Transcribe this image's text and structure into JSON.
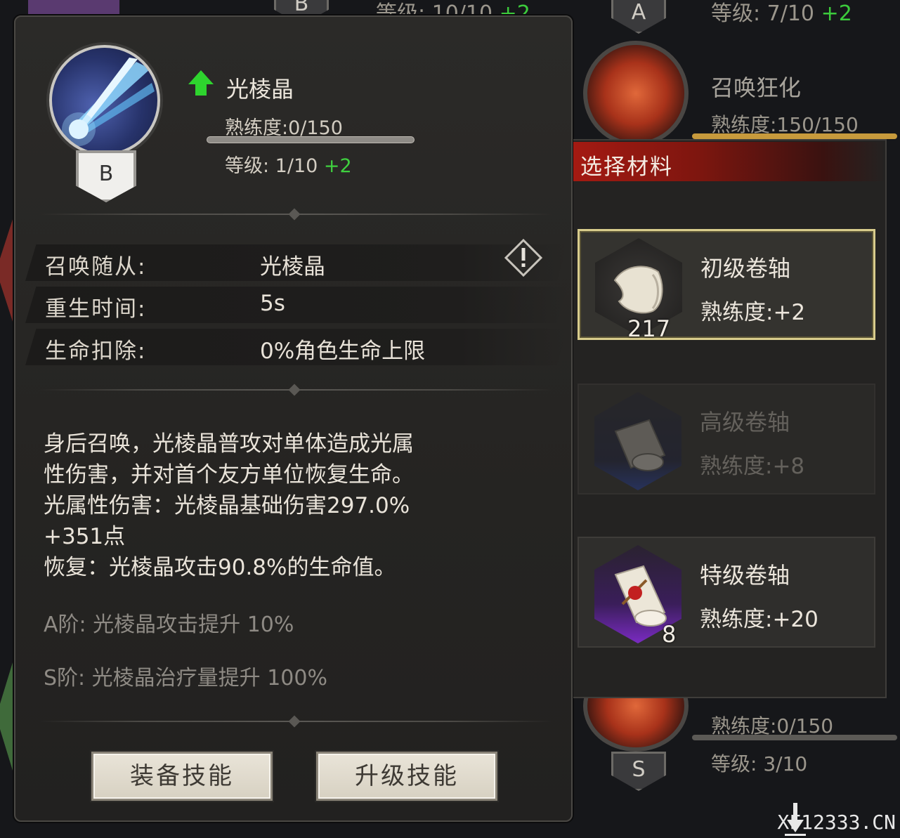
{
  "background": {
    "top_rank_left": "B",
    "top_level_left": "等级: 10/10",
    "top_level_left_plus": "+2",
    "top_rank_right": "A",
    "top_level_right": "等级: 7/10",
    "top_level_right_plus": "+2",
    "skill_right_name": "召唤狂化",
    "skill_right_prof": "熟练度:150/150",
    "bottom_prof": "熟练度:0/150",
    "bottom_level": "等级: 3/10",
    "bottom_rank": "S"
  },
  "skill": {
    "name": "光棱晶",
    "rank": "B",
    "proficiency": "熟练度:0/150",
    "proficiency_value": 0,
    "proficiency_max": 150,
    "level": "等级: 1/10",
    "level_plus": "+2"
  },
  "stats": [
    {
      "label": "召唤随从:",
      "value": "光棱晶"
    },
    {
      "label": "重生时间:",
      "value": "5s"
    },
    {
      "label": "生命扣除:",
      "value": "0%角色生命上限"
    }
  ],
  "description": {
    "lines": [
      "身后召唤，光棱晶普攻对单体造成光属",
      "性伤害，并对首个友方单位恢复生命。",
      "光属性伤害：光棱晶基础伤害297.0%",
      "+351点",
      "恢复：光棱晶攻击90.8%的生命值。"
    ]
  },
  "tiers": {
    "a": "A阶: 光棱晶攻击提升 10%",
    "s": "S阶: 光棱晶治疗量提升 100%"
  },
  "buttons": {
    "equip": "装备技能",
    "upgrade": "升级技能"
  },
  "materials": {
    "title": "选择材料",
    "items": [
      {
        "name": "初级卷轴",
        "proficiency": "熟练度:+2",
        "count": "217"
      },
      {
        "name": "高级卷轴",
        "proficiency": "熟练度:+8",
        "count": ""
      },
      {
        "name": "特级卷轴",
        "proficiency": "熟练度:+20",
        "count": "8"
      }
    ]
  },
  "watermark": "XF12333.CN",
  "colors": {
    "accent_green": "#3fd03f",
    "header_red": "#a41a12",
    "selected_border": "#d8cc8c"
  }
}
